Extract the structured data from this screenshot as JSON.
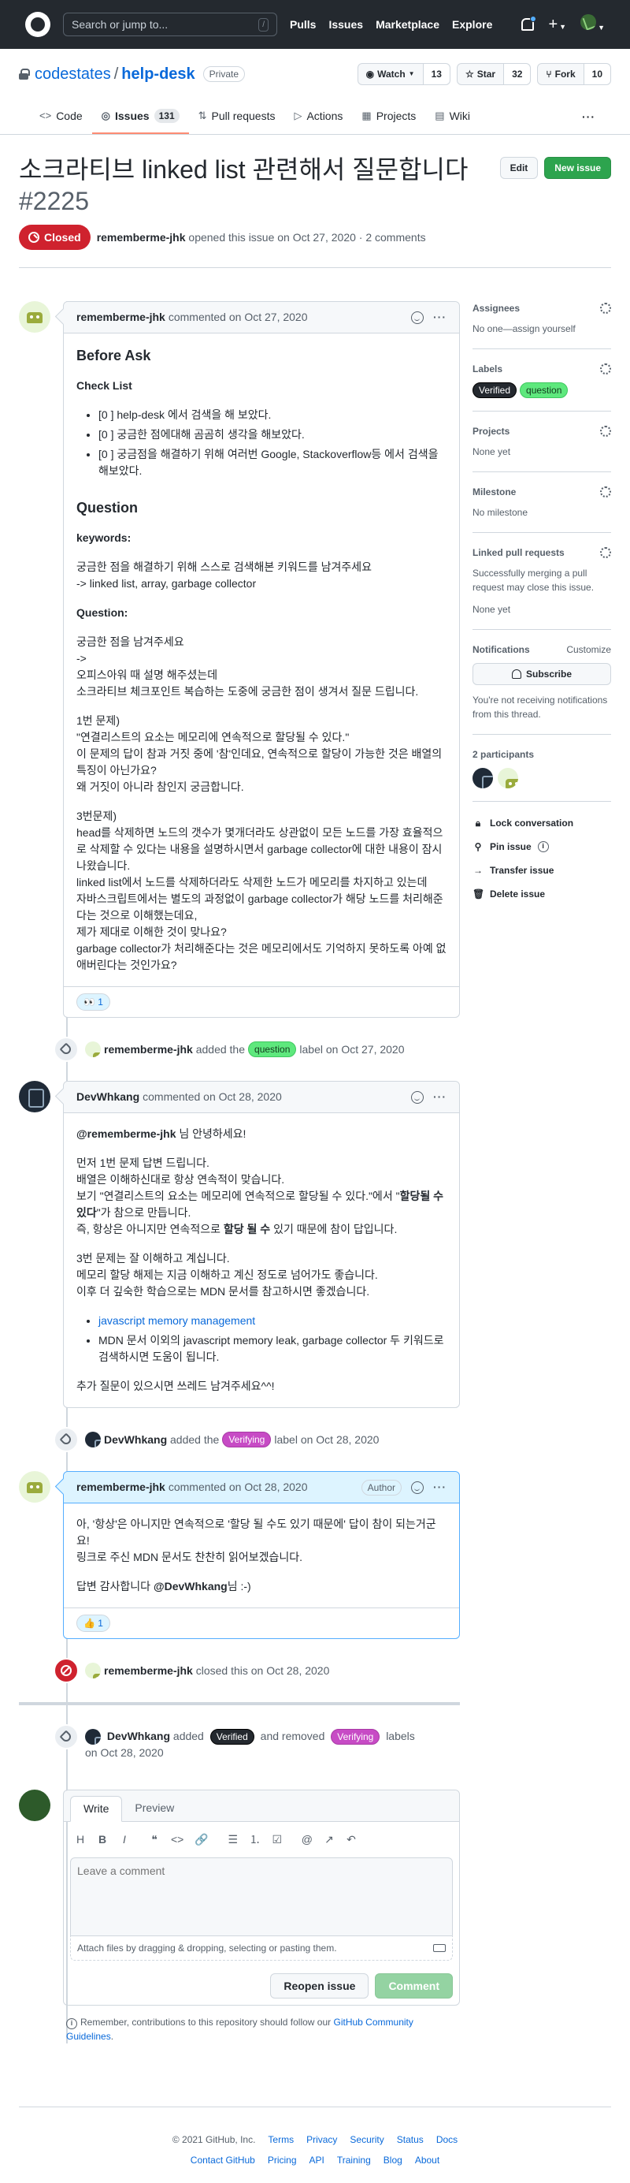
{
  "header": {
    "search_placeholder": "Search or jump to...",
    "search_key": "/",
    "nav": [
      "Pulls",
      "Issues",
      "Marketplace",
      "Explore"
    ]
  },
  "repo": {
    "owner": "codestates",
    "sep": "/",
    "name": "help-desk",
    "visibility": "Private",
    "watch_label": "Watch",
    "watch_count": "13",
    "star_label": "Star",
    "star_count": "32",
    "fork_label": "Fork",
    "fork_count": "10",
    "tabs": [
      {
        "label": "Code",
        "icon": "<>"
      },
      {
        "label": "Issues",
        "icon": "◎",
        "count": "131"
      },
      {
        "label": "Pull requests",
        "icon": "⇅"
      },
      {
        "label": "Actions",
        "icon": "▷"
      },
      {
        "label": "Projects",
        "icon": "▦"
      },
      {
        "label": "Wiki",
        "icon": "▤"
      }
    ],
    "more": "···"
  },
  "issue": {
    "title": "소크라티브 linked list 관련해서 질문합니다",
    "number": "#2225",
    "edit": "Edit",
    "new_issue": "New issue",
    "state": "Closed",
    "author": "rememberme-jhk",
    "opened_text": "opened this issue on Oct 27, 2020 · 2 comments"
  },
  "comments": [
    {
      "author": "rememberme-jhk",
      "when": "commented on Oct 27, 2020",
      "h_before": "Before Ask",
      "h_check": "Check List",
      "checks": [
        "[0 ] help-desk 에서 검색을 해 보았다.",
        "[0 ] 궁금한 점에대해 곰곰히 생각을 해보았다.",
        "[0 ] 궁금점을 해결하기 위해 여러번 Google, Stackoverflow등 에서 검색을 해보았다."
      ],
      "h_question": "Question",
      "h_keywords": "keywords:",
      "keywords_1": "궁금한 점을 해결하기 위해 스스로 검색해본 키워드를 남겨주세요",
      "keywords_2": "-> linked list, array, garbage collector",
      "h_q": "Question:",
      "q_1": "궁금한 점을 남겨주세요",
      "q_2": "->",
      "q_3": "오피스아워 때 설명 해주셨는데",
      "q_4": "소크라티브 체크포인트 복습하는 도중에 궁금한 점이 생겨서 질문 드립니다.",
      "p1_1": "1번 문제)",
      "p1_2": "\"연결리스트의 요소는 메모리에 연속적으로 할당될 수 있다.\"",
      "p1_3": "이 문제의 답이 참과 거짓 중에 '참'인데요, 연속적으로 할당이 가능한 것은 배열의 특징이 아닌가요?",
      "p1_4": "왜 거짓이 아니라 참인지 궁금합니다.",
      "p3_1": "3번문제)",
      "p3_2": "head를 삭제하면 노드의 갯수가 몇개더라도 상관없이 모든 노드를 가장 효율적으로 삭제할 수 있다는 내용을 설명하시면서 garbage collector에 대한 내용이 잠시 나왔습니다.",
      "p3_3": "linked list에서 노드를 삭제하더라도 삭제한 노드가 메모리를 차지하고 있는데",
      "p3_4": "자바스크립트에서는 별도의 과정없이 garbage collector가 해당 노드를 처리해준다는 것으로 이해했는데요,",
      "p3_5": "제가 제대로 이해한 것이 맞나요?",
      "p3_6": "garbage collector가 처리해준다는 것은 메모리에서도 기억하지 못하도록 아예 없애버린다는 것인가요?",
      "reaction": "👀",
      "reaction_count": "1"
    },
    {
      "author": "DevWhkang",
      "when": "commented on Oct 28, 2020",
      "greet_mention": "@rememberme-jhk",
      "greet_rest": " 님 안녕하세요!",
      "a1_1": "먼저 1번 문제 답변 드립니다.",
      "a1_2": "배열은 이해하신대로 항상 연속적이 맞습니다.",
      "a1_3a": "보기 \"연결리스트의 요소는 메모리에 연속적으로 할당될 수 있다.\"에서 \"",
      "a1_3b": "할당될 수 있다",
      "a1_3c": "\"가 참으로 만듭니다.",
      "a1_4a": "즉, 항상은 아니지만 연속적으로 ",
      "a1_4b": "할당 될 수",
      "a1_4c": " 있기 때문에 참이 답입니다.",
      "a3_1": "3번 문제는 잘 이해하고 계십니다.",
      "a3_2": "메모리 할당 해제는 지금 이해하고 계신 정도로 넘어가도 좋습니다.",
      "a3_3": "이후 더 깊숙한 학습으로는 MDN 문서를 참고하시면 좋겠습니다.",
      "link": "javascript memory management",
      "li2": "MDN 문서 이외의 javascript memory leak, garbage collector 두 키워드로 검색하시면 도움이 됩니다.",
      "closing": "추가 질문이 있으시면 쓰레드 남겨주세요^^!"
    },
    {
      "author": "rememberme-jhk",
      "when": "commented on Oct 28, 2020",
      "badge": "Author",
      "l1": "아, '항상'은 아니지만 연속적으로 '할당 될 수도 있기 때문에' 답이 참이 되는거군요!",
      "l2": "링크로 주신 MDN 문서도 찬찬히 읽어보겠습니다.",
      "l3a": "답변 감사합니다 ",
      "l3b": "@DevWhkang",
      "l3c": "님 :-)",
      "reaction": "👍",
      "reaction_count": "1"
    }
  ],
  "events": {
    "e1_user": "rememberme-jhk",
    "e1_a": "added the",
    "e1_label": "question",
    "e1_b": "label on Oct 27, 2020",
    "e2_user": "DevWhkang",
    "e2_a": "added the",
    "e2_label": "Verifying",
    "e2_b": "label on Oct 28, 2020",
    "e3_user": "rememberme-jhk",
    "e3_a": "closed this on Oct 28, 2020",
    "e4_user": "DevWhkang",
    "e4_a": "added",
    "e4_label1": "Verified",
    "e4_b": "and removed",
    "e4_label2": "Verifying",
    "e4_c": "labels",
    "e4_d": "on Oct 28, 2020"
  },
  "editor": {
    "tab_write": "Write",
    "tab_preview": "Preview",
    "tools": [
      "H",
      "B",
      "I",
      "❝",
      "<>",
      "🔗",
      "☰",
      "⒈",
      "☑",
      "@",
      "↗",
      "↶"
    ],
    "placeholder": "Leave a comment",
    "attach": "Attach files by dragging & dropping, selecting or pasting them.",
    "reopen": "Reopen issue",
    "comment": "Comment",
    "remember": "Remember, contributions to this repository should follow our ",
    "guidelines": "GitHub Community Guidelines",
    "remember_end": "."
  },
  "sidebar": {
    "assignees_h": "Assignees",
    "assignees_v": "No one—assign yourself",
    "labels_h": "Labels",
    "labels": [
      "Verified",
      "question"
    ],
    "projects_h": "Projects",
    "projects_v": "None yet",
    "milestone_h": "Milestone",
    "milestone_v": "No milestone",
    "linked_h": "Linked pull requests",
    "linked_desc": "Successfully merging a pull request may close this issue.",
    "linked_v": "None yet",
    "notif_h": "Notifications",
    "customize": "Customize",
    "subscribe": "Subscribe",
    "notif_desc": "You're not receiving notifications from this thread.",
    "participants_h": "2 participants",
    "lock": "Lock conversation",
    "pin": "Pin issue",
    "transfer": "Transfer issue",
    "delete": "Delete issue"
  },
  "footer": {
    "copyright": "© 2021 GitHub, Inc.",
    "row1": [
      "Terms",
      "Privacy",
      "Security",
      "Status",
      "Docs"
    ],
    "row2": [
      "Contact GitHub",
      "Pricing",
      "API",
      "Training",
      "Blog",
      "About"
    ]
  }
}
